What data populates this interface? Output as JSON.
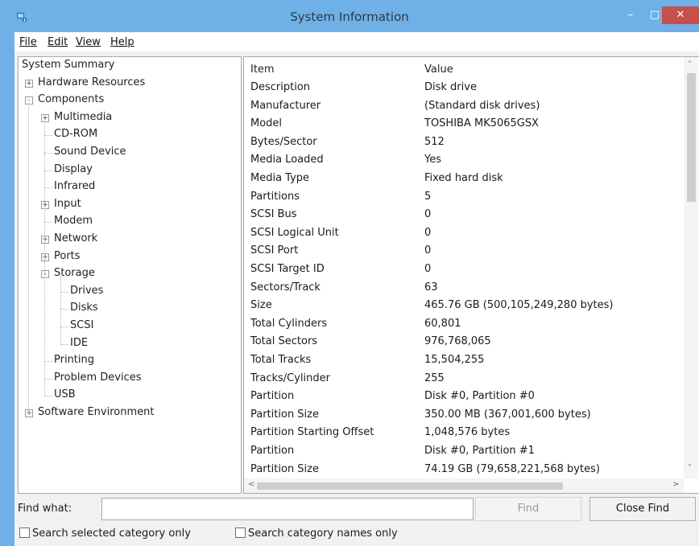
{
  "window": {
    "title": "System Information"
  },
  "menu": [
    {
      "label": "File"
    },
    {
      "label": "Edit"
    },
    {
      "label": "View"
    },
    {
      "label": "Help"
    }
  ],
  "tree": [
    {
      "label": "System Summary",
      "level": 0,
      "expander": "none"
    },
    {
      "label": "Hardware Resources",
      "level": 1,
      "expander": "+"
    },
    {
      "label": "Components",
      "level": 1,
      "expander": "-"
    },
    {
      "label": "Multimedia",
      "level": 2,
      "expander": "+"
    },
    {
      "label": "CD-ROM",
      "level": 2,
      "expander": "none"
    },
    {
      "label": "Sound Device",
      "level": 2,
      "expander": "none"
    },
    {
      "label": "Display",
      "level": 2,
      "expander": "none"
    },
    {
      "label": "Infrared",
      "level": 2,
      "expander": "none"
    },
    {
      "label": "Input",
      "level": 2,
      "expander": "+"
    },
    {
      "label": "Modem",
      "level": 2,
      "expander": "none"
    },
    {
      "label": "Network",
      "level": 2,
      "expander": "+"
    },
    {
      "label": "Ports",
      "level": 2,
      "expander": "+"
    },
    {
      "label": "Storage",
      "level": 2,
      "expander": "-"
    },
    {
      "label": "Drives",
      "level": 3,
      "expander": "none"
    },
    {
      "label": "Disks",
      "level": 3,
      "expander": "none"
    },
    {
      "label": "SCSI",
      "level": 3,
      "expander": "none"
    },
    {
      "label": "IDE",
      "level": 3,
      "expander": "none"
    },
    {
      "label": "Printing",
      "level": 2,
      "expander": "none"
    },
    {
      "label": "Problem Devices",
      "level": 2,
      "expander": "none"
    },
    {
      "label": "USB",
      "level": 2,
      "expander": "none"
    },
    {
      "label": "Software Environment",
      "level": 1,
      "expander": "+"
    }
  ],
  "details": {
    "headers": {
      "item": "Item",
      "value": "Value"
    },
    "rows": [
      {
        "item": "Description",
        "value": "Disk drive"
      },
      {
        "item": "Manufacturer",
        "value": "(Standard disk drives)"
      },
      {
        "item": "Model",
        "value": "TOSHIBA MK5065GSX"
      },
      {
        "item": "Bytes/Sector",
        "value": "512"
      },
      {
        "item": "Media Loaded",
        "value": "Yes"
      },
      {
        "item": "Media Type",
        "value": "Fixed hard disk"
      },
      {
        "item": "Partitions",
        "value": "5"
      },
      {
        "item": "SCSI Bus",
        "value": "0"
      },
      {
        "item": "SCSI Logical Unit",
        "value": "0"
      },
      {
        "item": "SCSI Port",
        "value": "0"
      },
      {
        "item": "SCSI Target ID",
        "value": "0"
      },
      {
        "item": "Sectors/Track",
        "value": "63"
      },
      {
        "item": "Size",
        "value": "465.76 GB (500,105,249,280 bytes)"
      },
      {
        "item": "Total Cylinders",
        "value": "60,801"
      },
      {
        "item": "Total Sectors",
        "value": "976,768,065"
      },
      {
        "item": "Total Tracks",
        "value": "15,504,255"
      },
      {
        "item": "Tracks/Cylinder",
        "value": "255"
      },
      {
        "item": "Partition",
        "value": "Disk #0, Partition #0"
      },
      {
        "item": "Partition Size",
        "value": "350.00 MB (367,001,600 bytes)"
      },
      {
        "item": "Partition Starting Offset",
        "value": "1,048,576 bytes"
      },
      {
        "item": "Partition",
        "value": "Disk #0, Partition #1"
      },
      {
        "item": "Partition Size",
        "value": "74.19 GB (79,658,221,568 bytes)"
      }
    ]
  },
  "find": {
    "label": "Find what:",
    "value": "",
    "find_button": "Find",
    "close_button": "Close Find",
    "check_selected": "Search selected category only",
    "check_names": "Search category names only"
  },
  "icons": {
    "minimize": "minimize-icon",
    "maximize": "maximize-icon",
    "close": "close-icon"
  },
  "colors": {
    "titlebar": "#6fb1e6",
    "close": "#c7504b"
  }
}
